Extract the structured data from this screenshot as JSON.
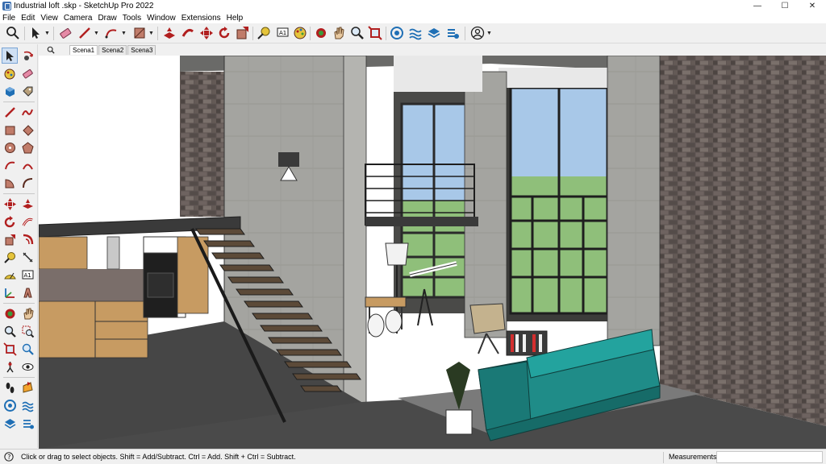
{
  "window": {
    "title": "Industrial loft .skp - SketchUp Pro 2022",
    "minimize_glyph": "—",
    "maximize_glyph": "☐",
    "close_glyph": "✕"
  },
  "menu": [
    "File",
    "Edit",
    "View",
    "Camera",
    "Draw",
    "Tools",
    "Window",
    "Extensions",
    "Help"
  ],
  "top_toolbar_icons": [
    "search-icon",
    "select-arrow-icon",
    "eraser-icon",
    "pencil-line-icon",
    "arc-icon",
    "paint-bucket-icon",
    "push-pull-icon",
    "follow-me-icon",
    "move-icon",
    "rotate-icon",
    "offset-icon",
    "tape-measure-icon",
    "text-icon",
    "paint-icon",
    "orbit-icon",
    "hand-pan-icon",
    "zoom-icon",
    "zoom-extents-icon",
    "warehouse-icon",
    "sandbox-icon",
    "layers-icon",
    "extension-icon",
    "user-account-icon"
  ],
  "left_toolbar_icons": [
    "select-icon",
    "orbit-select-icon",
    "paint-bucket-icon",
    "eraser-icon",
    "component-icon",
    "tag-icon",
    "line-icon",
    "freehand-icon",
    "rectangle-icon",
    "rotated-rectangle-icon",
    "circle-icon",
    "polygon-icon",
    "arc-icon",
    "two-point-arc-icon",
    "pie-icon",
    "three-point-arc-icon",
    "move-icon",
    "push-pull-icon",
    "rotate-icon",
    "follow-me-icon",
    "scale-icon",
    "offset-icon",
    "tape-measure-icon",
    "dimension-icon",
    "protractor-icon",
    "text-icon",
    "axes-icon",
    "3d-text-icon",
    "orbit-icon",
    "pan-icon",
    "zoom-icon",
    "zoom-window-icon",
    "zoom-extents-icon",
    "previous-view-icon",
    "position-camera-icon",
    "look-around-icon",
    "walk-icon",
    "section-plane-icon",
    "warehouse-icon",
    "extension-warehouse-icon",
    "layout-icon",
    "ruby-icon"
  ],
  "scenes": {
    "tabs": [
      "Scena1",
      "Scena2",
      "Scena3"
    ],
    "active": "Scena1"
  },
  "statusbar": {
    "hint": "Click or drag to select objects. Shift = Add/Subtract. Ctrl = Add. Shift + Ctrl = Subtract.",
    "measurements_label": "Measurements",
    "measurements_value": ""
  },
  "colors": {
    "brick": "#5a4f4b",
    "concrete": "#a9a9a4",
    "floor": "#4a4a4a",
    "sofa": "#1f8c88",
    "wood": "#c79b62",
    "sky": "#a8c8e8",
    "grass": "#8fbf7a",
    "accent": "#d32f2f"
  }
}
